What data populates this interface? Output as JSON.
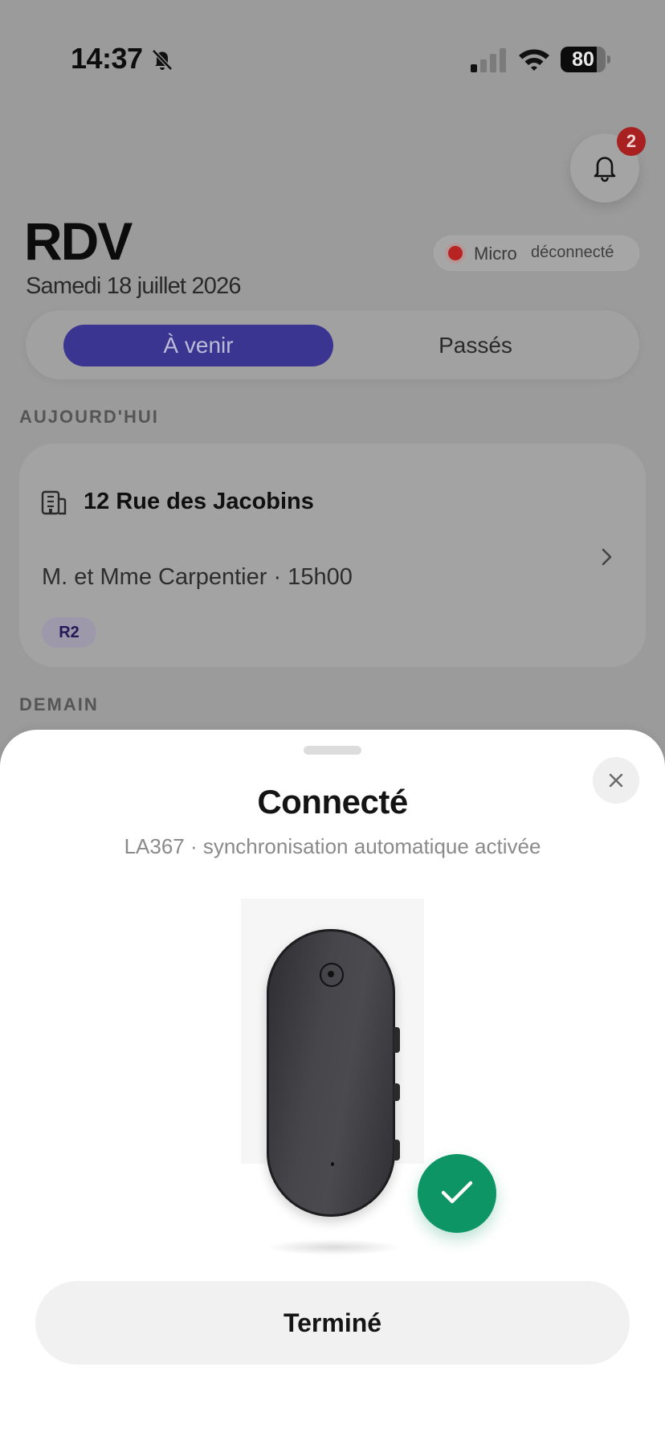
{
  "status_bar": {
    "time": "14:37",
    "battery": "80",
    "battery_level": 0.8
  },
  "notifications": {
    "count": "2",
    "icon": "bell-icon"
  },
  "header": {
    "title": "RDV",
    "date": "Samedi 18 juillet 2026"
  },
  "micro": {
    "label": "Micro",
    "status": "déconnecté",
    "status_color": "#b82424"
  },
  "tabs": {
    "upcoming": "À venir",
    "past": "Passés",
    "active": "upcoming",
    "accent": "#3a3591"
  },
  "sections": {
    "today": "AUJOURD'HUI",
    "tomorrow": "DEMAIN"
  },
  "appointment": {
    "address": "12 Rue des Jacobins",
    "detail": "M. et Mme Carpentier · 15h00",
    "tag": "R2",
    "icon": "building-icon"
  },
  "sheet": {
    "title": "Connecté",
    "subtitle": "LA367 · synchronisation automatique activée",
    "success_color": "#0d9566",
    "done_label": "Terminé",
    "close_icon": "close-icon"
  }
}
